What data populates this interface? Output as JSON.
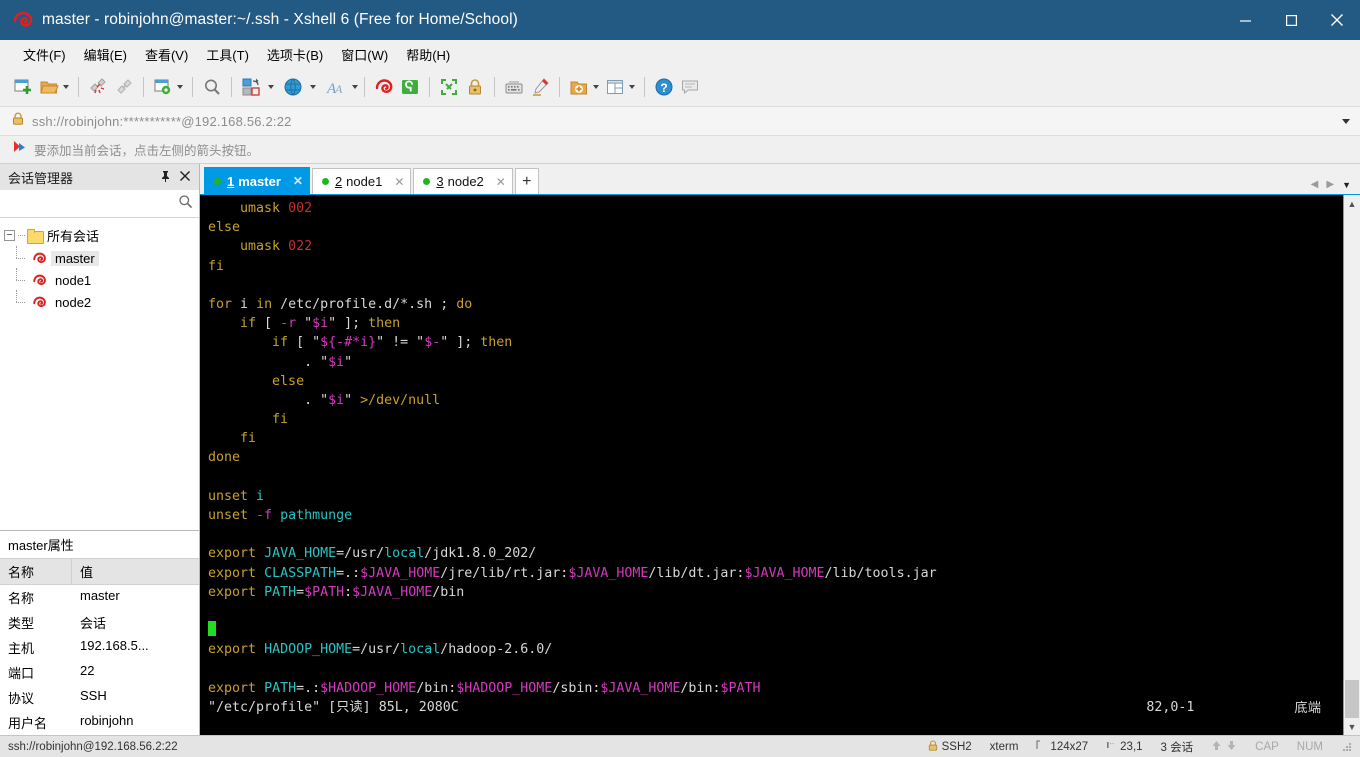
{
  "window": {
    "title": "master - robinjohn@master:~/.ssh - Xshell 6 (Free for Home/School)",
    "app_icon": "xshell-logo-icon",
    "minimize": "—",
    "maximize": "☐",
    "close": "✕"
  },
  "menubar": {
    "items": [
      {
        "label": "文件(F)",
        "name": "menu-file"
      },
      {
        "label": "编辑(E)",
        "name": "menu-edit"
      },
      {
        "label": "查看(V)",
        "name": "menu-view"
      },
      {
        "label": "工具(T)",
        "name": "menu-tools"
      },
      {
        "label": "选项卡(B)",
        "name": "menu-tabs"
      },
      {
        "label": "窗口(W)",
        "name": "menu-window"
      },
      {
        "label": "帮助(H)",
        "name": "menu-help"
      }
    ]
  },
  "toolbar": {
    "icons": [
      "new-session-icon",
      "open-folder-icon",
      "disconnect-icon",
      "reconnect-icon",
      "session-properties-icon",
      "find-icon",
      "file-transfer-icon",
      "globe-icon",
      "font-icon",
      "xshell-icon",
      "green-terminal-icon",
      "fullscreen-icon",
      "lock-icon",
      "keyboard-icon",
      "highlight-pen-icon",
      "add-to-folder-icon",
      "layout-icon",
      "help-icon",
      "comment-icon"
    ]
  },
  "urlbar": {
    "lock_icon": "lock-icon",
    "value": "ssh://robinjohn:***********@192.168.56.2:22",
    "dropdown_icon": "chevron-down-icon"
  },
  "hintbar": {
    "icon": "arrow-flag-icon",
    "text": "要添加当前会话，点击左侧的箭头按钮。"
  },
  "sidebar": {
    "title": "会话管理器",
    "pin_icon": "pin-icon",
    "close_icon": "close-icon",
    "search_placeholder": "",
    "search_value": "",
    "search_icon": "search-icon",
    "root": {
      "label": "所有会话",
      "expander": "−",
      "icon": "folder-icon"
    },
    "sessions": [
      {
        "label": "master",
        "icon": "session-icon",
        "selected": true
      },
      {
        "label": "node1",
        "icon": "session-icon",
        "selected": false
      },
      {
        "label": "node2",
        "icon": "session-icon",
        "selected": false
      }
    ],
    "properties": {
      "title": "master属性",
      "col_name": "名称",
      "col_value": "值",
      "rows": [
        {
          "name": "名称",
          "value": "master"
        },
        {
          "name": "类型",
          "value": "会话"
        },
        {
          "name": "主机",
          "value": "192.168.5..."
        },
        {
          "name": "端口",
          "value": "22"
        },
        {
          "name": "协议",
          "value": "SSH"
        },
        {
          "name": "用户名",
          "value": "robinjohn"
        }
      ]
    }
  },
  "tabs": {
    "items": [
      {
        "num": "1",
        "label": "master",
        "active": true,
        "close_icon": "close-icon",
        "status_icon": "connected-dot-icon"
      },
      {
        "num": "2",
        "label": "node1",
        "active": false,
        "close_icon": "close-icon",
        "status_icon": "connected-dot-icon"
      },
      {
        "num": "3",
        "label": "node2",
        "active": false,
        "close_icon": "close-icon",
        "status_icon": "connected-dot-icon"
      }
    ],
    "add_label": "+",
    "nav_left_icon": "chevron-left-icon",
    "nav_right_icon": "chevron-right-icon",
    "nav_down_icon": "chevron-down-icon"
  },
  "terminal": {
    "scroll_up_icon": "chevron-up-icon",
    "scroll_down_icon": "chevron-down-icon",
    "lines": [
      [
        {
          "t": "    umask ",
          "c": "yellow"
        },
        {
          "t": "002",
          "c": "red"
        }
      ],
      [
        {
          "t": "else",
          "c": "yellow"
        }
      ],
      [
        {
          "t": "    umask ",
          "c": "yellow"
        },
        {
          "t": "022",
          "c": "red"
        }
      ],
      [
        {
          "t": "fi",
          "c": "yellow"
        }
      ],
      [
        {
          "t": "",
          "c": "white"
        }
      ],
      [
        {
          "t": "for",
          "c": "yellow"
        },
        {
          "t": " i ",
          "c": "white"
        },
        {
          "t": "in",
          "c": "yellow"
        },
        {
          "t": " /etc/profile.d/*.sh ; ",
          "c": "white"
        },
        {
          "t": "do",
          "c": "yellow"
        }
      ],
      [
        {
          "t": "    ",
          "c": "white"
        },
        {
          "t": "if",
          "c": "yellow"
        },
        {
          "t": " [ ",
          "c": "white"
        },
        {
          "t": "-r",
          "c": "magenta"
        },
        {
          "t": " \"",
          "c": "white"
        },
        {
          "t": "$i",
          "c": "magenta"
        },
        {
          "t": "\" ]; ",
          "c": "white"
        },
        {
          "t": "then",
          "c": "yellow"
        }
      ],
      [
        {
          "t": "        ",
          "c": "white"
        },
        {
          "t": "if",
          "c": "yellow"
        },
        {
          "t": " [ \"",
          "c": "white"
        },
        {
          "t": "${-#*i}",
          "c": "magenta"
        },
        {
          "t": "\" != \"",
          "c": "white"
        },
        {
          "t": "$-",
          "c": "magenta"
        },
        {
          "t": "\" ]; ",
          "c": "white"
        },
        {
          "t": "then",
          "c": "yellow"
        }
      ],
      [
        {
          "t": "            . \"",
          "c": "white"
        },
        {
          "t": "$i",
          "c": "magenta"
        },
        {
          "t": "\"",
          "c": "white"
        }
      ],
      [
        {
          "t": "        ",
          "c": "white"
        },
        {
          "t": "else",
          "c": "yellow"
        }
      ],
      [
        {
          "t": "            . \"",
          "c": "white"
        },
        {
          "t": "$i",
          "c": "magenta"
        },
        {
          "t": "\" ",
          "c": "white"
        },
        {
          "t": ">/dev/null",
          "c": "yellow"
        }
      ],
      [
        {
          "t": "        ",
          "c": "white"
        },
        {
          "t": "fi",
          "c": "yellow"
        }
      ],
      [
        {
          "t": "    ",
          "c": "white"
        },
        {
          "t": "fi",
          "c": "yellow"
        }
      ],
      [
        {
          "t": "done",
          "c": "yellow"
        }
      ],
      [
        {
          "t": "",
          "c": "white"
        }
      ],
      [
        {
          "t": "unset",
          "c": "yellow"
        },
        {
          "t": " ",
          "c": "white"
        },
        {
          "t": "i",
          "c": "cyan"
        }
      ],
      [
        {
          "t": "unset",
          "c": "yellow"
        },
        {
          "t": " ",
          "c": "white"
        },
        {
          "t": "-f",
          "c": "magenta"
        },
        {
          "t": " ",
          "c": "white"
        },
        {
          "t": "pathmunge",
          "c": "cyan"
        }
      ],
      [
        {
          "t": "",
          "c": "white"
        }
      ],
      [
        {
          "t": "export",
          "c": "yellow"
        },
        {
          "t": " ",
          "c": "white"
        },
        {
          "t": "JAVA_HOME",
          "c": "cyan"
        },
        {
          "t": "=/usr/",
          "c": "white"
        },
        {
          "t": "local",
          "c": "cyan"
        },
        {
          "t": "/jdk1.8.0_202/",
          "c": "white"
        }
      ],
      [
        {
          "t": "export",
          "c": "yellow"
        },
        {
          "t": " ",
          "c": "white"
        },
        {
          "t": "CLASSPATH",
          "c": "cyan"
        },
        {
          "t": "=.:",
          "c": "white"
        },
        {
          "t": "$JAVA_HOME",
          "c": "magenta"
        },
        {
          "t": "/jre/lib/rt.jar:",
          "c": "white"
        },
        {
          "t": "$JAVA_HOME",
          "c": "magenta"
        },
        {
          "t": "/lib/dt.jar:",
          "c": "white"
        },
        {
          "t": "$JAVA_HOME",
          "c": "magenta"
        },
        {
          "t": "/lib/tools.jar",
          "c": "white"
        }
      ],
      [
        {
          "t": "export",
          "c": "yellow"
        },
        {
          "t": " ",
          "c": "white"
        },
        {
          "t": "PATH",
          "c": "cyan"
        },
        {
          "t": "=",
          "c": "white"
        },
        {
          "t": "$PATH",
          "c": "magenta"
        },
        {
          "t": ":",
          "c": "white"
        },
        {
          "t": "$JAVA_HOME",
          "c": "magenta"
        },
        {
          "t": "/bin",
          "c": "white"
        }
      ],
      [
        {
          "t": "",
          "c": "white"
        }
      ],
      [
        {
          "t": "CURSOR",
          "c": "cursor"
        }
      ],
      [
        {
          "t": "export",
          "c": "yellow"
        },
        {
          "t": " ",
          "c": "white"
        },
        {
          "t": "HADOOP_HOME",
          "c": "cyan"
        },
        {
          "t": "=/usr/",
          "c": "white"
        },
        {
          "t": "local",
          "c": "cyan"
        },
        {
          "t": "/hadoop-2.6.0/",
          "c": "white"
        }
      ],
      [
        {
          "t": "",
          "c": "white"
        }
      ],
      [
        {
          "t": "export",
          "c": "yellow"
        },
        {
          "t": " ",
          "c": "white"
        },
        {
          "t": "PATH",
          "c": "cyan"
        },
        {
          "t": "=.:",
          "c": "white"
        },
        {
          "t": "$HADOOP_HOME",
          "c": "magenta"
        },
        {
          "t": "/bin:",
          "c": "white"
        },
        {
          "t": "$HADOOP_HOME",
          "c": "magenta"
        },
        {
          "t": "/sbin:",
          "c": "white"
        },
        {
          "t": "$JAVA_HOME",
          "c": "magenta"
        },
        {
          "t": "/bin:",
          "c": "white"
        },
        {
          "t": "$PATH",
          "c": "magenta"
        }
      ],
      [
        {
          "t": "\"/etc/profile\" [只读] 85L, 2080C",
          "c": "white"
        }
      ]
    ],
    "status_line": {
      "file": "\"/etc/profile\" [只读] 85L, 2080C",
      "position": "82,0-1",
      "scroll_pos": "底端"
    }
  },
  "statusbar": {
    "connection": "ssh://robinjohn@192.168.56.2:22",
    "lock_icon": "lock-icon",
    "protocol": "SSH2",
    "term_type": "xterm",
    "size_icon": "size-icon",
    "size": "124x27",
    "cursor_icon": "cursor-pos-icon",
    "cursor": "23,1",
    "sessions": "3 会话",
    "up_icon": "arrow-up-icon",
    "down_icon": "arrow-down-icon",
    "cap": "CAP",
    "num": "NUM",
    "grip_icon": "resize-grip-icon"
  },
  "colors": {
    "titlebar": "#235a84",
    "accent_tab": "#0099e6",
    "terminal_bg": "#000000",
    "terminal_white": "#d8d8d8",
    "terminal_yellow": "#c8a02a",
    "terminal_red": "#c13030",
    "terminal_magenta": "#d33abf",
    "terminal_cyan": "#29c3c3",
    "cursor_green": "#22dd22"
  }
}
